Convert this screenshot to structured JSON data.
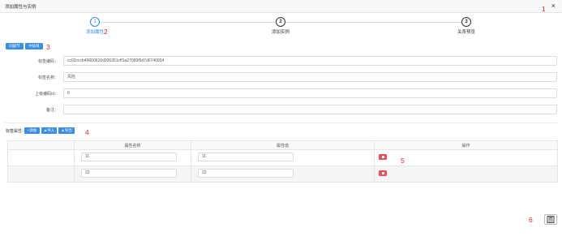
{
  "dialog": {
    "title": "添加属性与实例",
    "close_glyph": "×"
  },
  "markers": [
    "1",
    "2",
    "3",
    "4",
    "5",
    "6"
  ],
  "steps": [
    {
      "num": "1",
      "label": "添加属性",
      "state": "active"
    },
    {
      "num": "2",
      "label": "添加实例",
      "state": "pending"
    },
    {
      "num": "3",
      "label": "关系预览",
      "state": "pending"
    }
  ],
  "toolbar": {
    "btn1": "同级节",
    "btn2": "中级目"
  },
  "form": {
    "code_label": "标签编码：",
    "code_value": "cc02cccb49660616d326351cff1a27099f5d7d0740924",
    "name_label": "标签名称：",
    "name_value": "风险",
    "parent_label": "上级编码id：",
    "parent_value": "0",
    "remark_label": "备注：",
    "remark_value": ""
  },
  "attrs": {
    "section_label": "标签属性：",
    "add_label": "添加",
    "import_label": "导入",
    "export_label": "导出",
    "columns": [
      "属性名称",
      "属性值",
      "操作"
    ],
    "rows": [
      {
        "name": "11",
        "value": "11"
      },
      {
        "name": "22",
        "value": "22"
      }
    ]
  },
  "icons": {
    "close": "close-icon",
    "calc": "calculator-icon",
    "delete": "trash-icon"
  },
  "colors": {
    "accent": "#2d8cf0",
    "button": "#3a8ee6",
    "danger": "#ed4f5b",
    "marker": "#e02424"
  }
}
